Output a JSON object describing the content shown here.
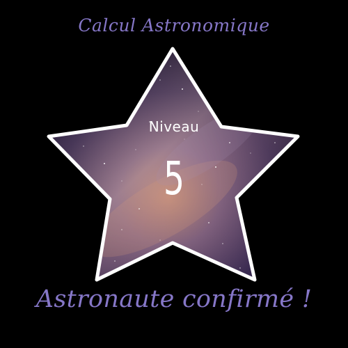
{
  "header": {
    "title": "Calcul Astronomique"
  },
  "badge": {
    "level_label": "Niveau",
    "level_number": "5",
    "rank_title": "Astronaute confirmé !",
    "star_image": "milky-way-night-sky"
  },
  "colors": {
    "background": "#000000",
    "accent": "#8677c8",
    "star_outline": "#ffffff",
    "text_light": "#ffffff",
    "sky_dark": "#1b1430",
    "sky_mid": "#5e4a78",
    "sky_glow": "#c58d78"
  }
}
